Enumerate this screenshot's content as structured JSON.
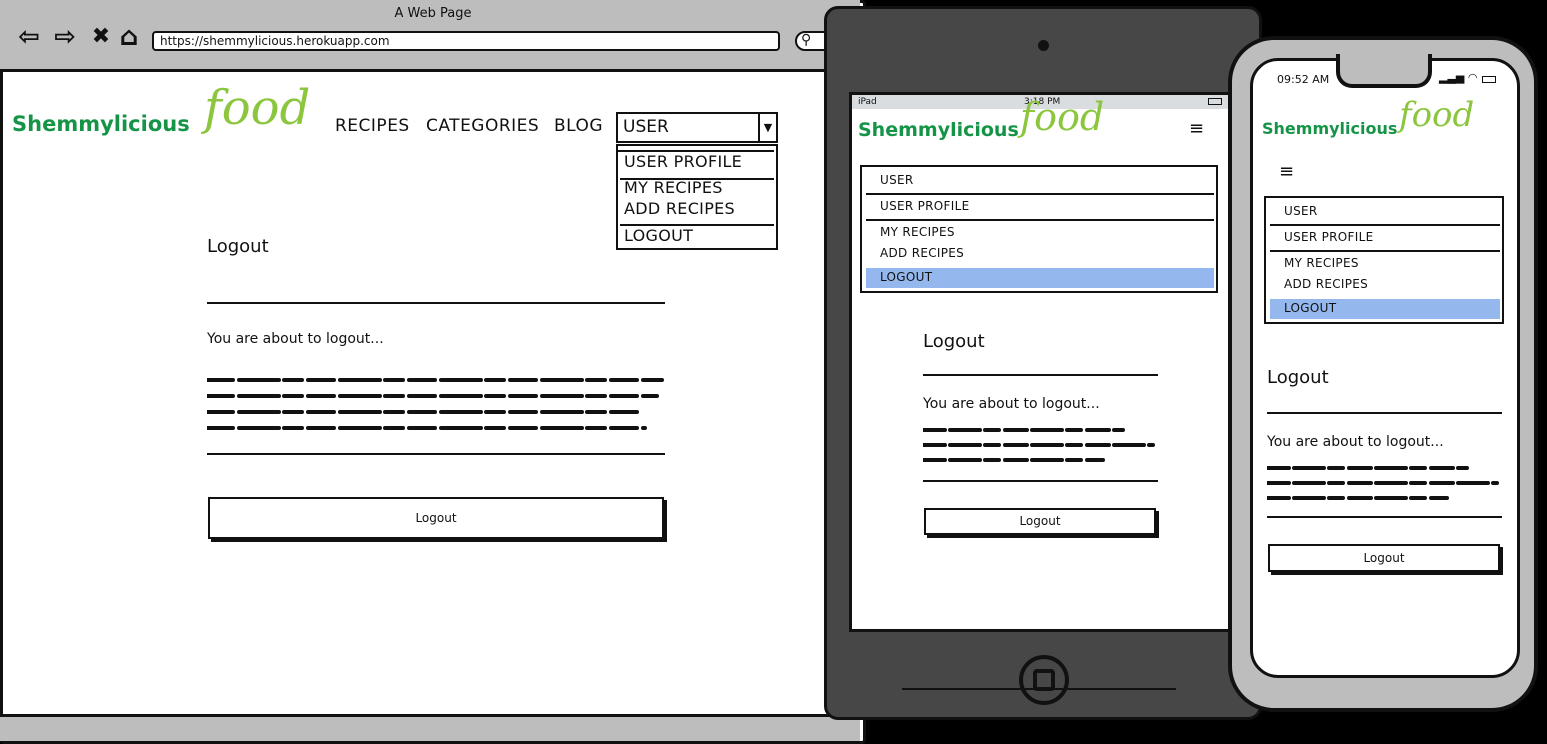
{
  "browser": {
    "window_title": "A Web Page",
    "url": "https://shemmylicious.herokuapp.com"
  },
  "logo": {
    "word": "Shemmylicious",
    "script": "food"
  },
  "nav": {
    "recipes": "RECIPES",
    "categories": "CATEGORIES",
    "blog": "BLOG",
    "user": "USER"
  },
  "user_menu": {
    "user": "USER",
    "profile": "USER PROFILE",
    "my_recipes": "MY RECIPES",
    "add_recipes": "ADD RECIPES",
    "logout": "LOGOUT"
  },
  "logout_page": {
    "title": "Logout",
    "message": "You are about to logout...",
    "button": "Logout"
  },
  "tablet": {
    "device": "iPad",
    "time": "3:18 PM"
  },
  "phone": {
    "time": "09:52 AM"
  },
  "colors": {
    "logo_green": "#159447",
    "script_green": "#8cc63f",
    "highlight": "#94b8ed",
    "chrome_gray": "#bdbdbd"
  }
}
